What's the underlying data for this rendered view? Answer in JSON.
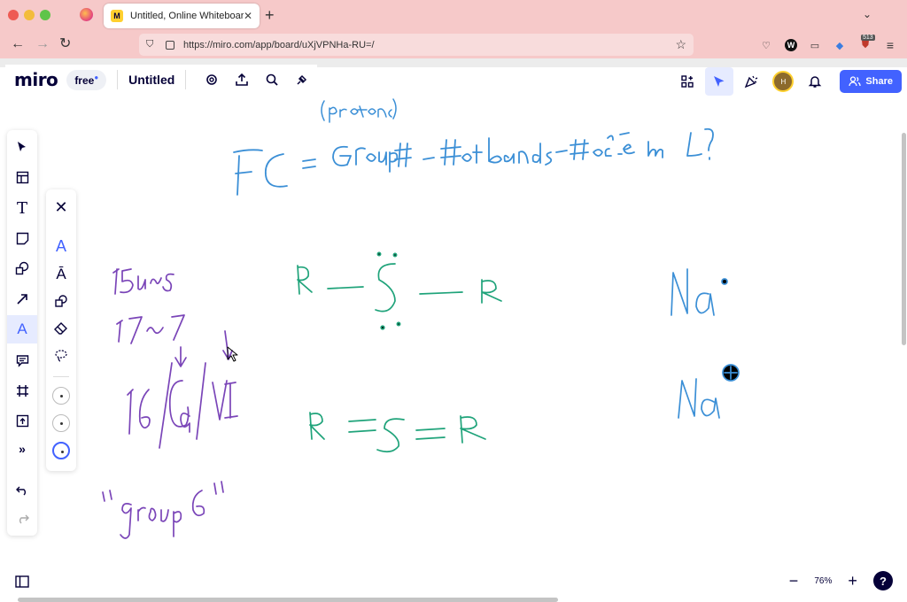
{
  "browser": {
    "tab_title": "Untitled, Online Whiteboard for",
    "tab_favicon": "M",
    "url": "https://miro.com/app/board/uXjVPNHa-RU=/",
    "extension_badge": "513"
  },
  "miro": {
    "logo": "miro",
    "plan": "free",
    "board_name": "Untitled",
    "share_label": "Share",
    "avatar_initial": "H",
    "zoom": "76%",
    "help": "?"
  },
  "colors": {
    "blue_ink": "#3b8fd6",
    "green_ink": "#1fa37a",
    "purple_ink": "#7a45b8",
    "accent": "#4262ff"
  },
  "icons": {
    "left_toolbar": [
      "select-icon",
      "templates-icon",
      "text-icon",
      "sticky-note-icon",
      "shapes-icon",
      "arrow-icon",
      "pen-icon",
      "comment-icon",
      "frame-icon",
      "upload-icon",
      "more-tools-icon",
      "undo-icon",
      "redo-icon"
    ],
    "pen_panel": [
      "close-icon",
      "pen-icon",
      "highlighter-icon",
      "smart-drawing-icon",
      "eraser-icon",
      "lasso-icon"
    ]
  }
}
